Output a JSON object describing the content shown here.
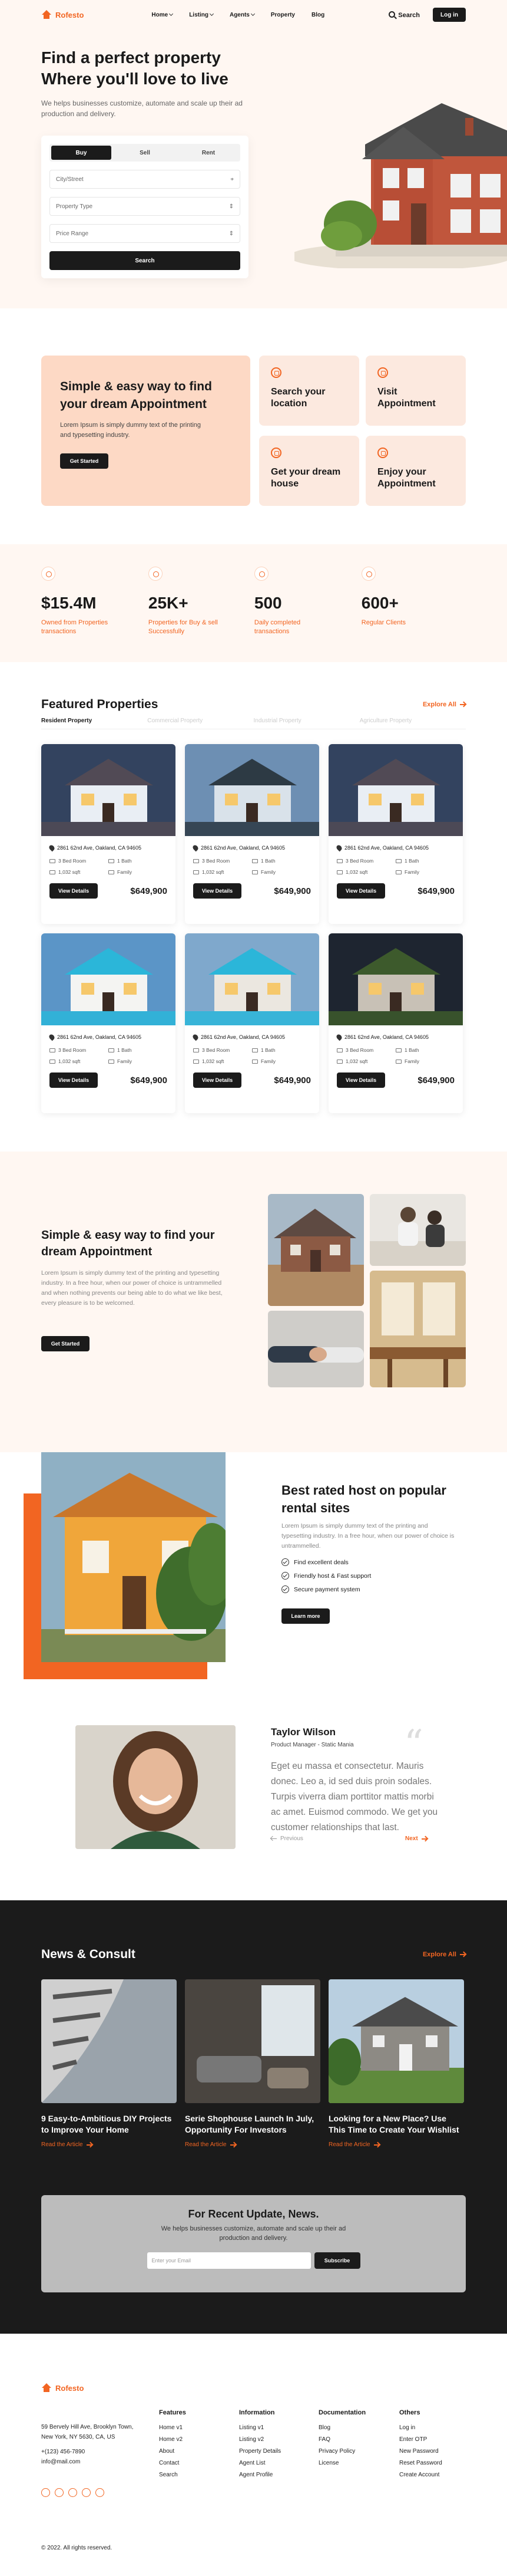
{
  "nav": {
    "brand": "Rofesto",
    "links": [
      "Home",
      "Listing",
      "Agents",
      "Property",
      "Blog"
    ],
    "search": "Search",
    "login": "Log in"
  },
  "hero": {
    "title": "Find a perfect property Where you'll love to live",
    "subtitle": "We helps businesses customize, automate and scale up their ad production and delivery.",
    "tabs": [
      "Buy",
      "Sell",
      "Rent"
    ],
    "fields": [
      "City/Street",
      "Property Type",
      "Price Range"
    ],
    "search_button": "Search"
  },
  "services": {
    "title": "Simple & easy way to find your dream Appointment",
    "text": "Lorem Ipsum is simply dummy text of the printing and typesetting industry.",
    "button": "Get Started",
    "cards": [
      "Search your location",
      "Visit Appointment",
      "Get your dream house",
      "Enjoy your Appointment"
    ]
  },
  "stats": [
    {
      "value": "$15.4M",
      "label": "Owned from Properties transactions"
    },
    {
      "value": "25K+",
      "label": "Properties for Buy & sell Successfully"
    },
    {
      "value": "500",
      "label": "Daily completed transactions"
    },
    {
      "value": "600+",
      "label": "Regular Clients"
    }
  ],
  "featured": {
    "title": "Featured Properties",
    "explore": "Explore All",
    "tabs": [
      "Resident Property",
      "Commercial Property",
      "Industrial Property",
      "Agriculture Property"
    ],
    "cards": [
      {
        "address": "2861 62nd Ave, Oakland, CA 94605",
        "bed": "3 Bed Room",
        "bath": "1 Bath",
        "area": "1,032 sqft",
        "type": "Family",
        "button": "View Details",
        "price": "$649,900"
      },
      {
        "address": "2861 62nd Ave, Oakland, CA 94605",
        "bed": "3 Bed Room",
        "bath": "1 Bath",
        "area": "1,032 sqft",
        "type": "Family",
        "button": "View Details",
        "price": "$649,900"
      },
      {
        "address": "2861 62nd Ave, Oakland, CA 94605",
        "bed": "3 Bed Room",
        "bath": "1 Bath",
        "area": "1,032 sqft",
        "type": "Family",
        "button": "View Details",
        "price": "$649,900"
      },
      {
        "address": "2861 62nd Ave, Oakland, CA 94605",
        "bed": "3 Bed Room",
        "bath": "1 Bath",
        "area": "1,032 sqft",
        "type": "Family",
        "button": "View Details",
        "price": "$649,900"
      },
      {
        "address": "2861 62nd Ave, Oakland, CA 94605",
        "bed": "3 Bed Room",
        "bath": "1 Bath",
        "area": "1,032 sqft",
        "type": "Family",
        "button": "View Details",
        "price": "$649,900"
      },
      {
        "address": "2861 62nd Ave, Oakland, CA 94605",
        "bed": "3 Bed Room",
        "bath": "1 Bath",
        "area": "1,032 sqft",
        "type": "Family",
        "button": "View Details",
        "price": "$649,900"
      }
    ]
  },
  "appointment": {
    "title": "Simple & easy way to find your dream Appointment",
    "text": "Lorem Ipsum is simply dummy text of the printing and typesetting industry. In a free hour, when our power of choice is untrammelled and when nothing prevents our being able to do what we like best, every pleasure is to be welcomed.",
    "button": "Get Started"
  },
  "host": {
    "title": "Best rated host on popular rental sites",
    "text": "Lorem Ipsum is simply dummy text of the printing and typesetting industry. In a free hour, when our power of choice is untrammelled.",
    "items": [
      "Find excellent deals",
      "Friendly host & Fast support",
      "Secure payment system"
    ],
    "button": "Learn more"
  },
  "testimonial": {
    "name": "Taylor Wilson",
    "role": "Product Manager - Static Mania",
    "quote": "Eget eu massa et consectetur. Mauris donec. Leo a, id sed duis proin sodales. Turpis viverra diam porttitor mattis morbi ac amet. Euismod commodo. We get you customer relationships that last.",
    "prev": "Previous",
    "next": "Next"
  },
  "news": {
    "title": "News & Consult",
    "explore": "Explore All",
    "articles": [
      {
        "title": "9 Easy-to-Ambitious DIY Projects to Improve Your Home",
        "link": "Read the Article"
      },
      {
        "title": "Serie Shophouse Launch In July, Opportunity For Investors",
        "link": "Read the Article"
      },
      {
        "title": "Looking for a New Place? Use This Time to Create Your Wishlist",
        "link": "Read the Article"
      }
    ],
    "newsletter": {
      "title": "For Recent Update, News.",
      "text": "We helps businesses customize, automate and scale up their ad production and delivery.",
      "placeholder": "Enter your Email",
      "button": "Subscribe"
    }
  },
  "footer": {
    "brand": "Rofesto",
    "address": "59 Bervely Hill Ave, Brooklyn Town, New York, NY 5630, CA, US",
    "phone": "+(123) 456-7890",
    "email": "info@mail.com",
    "columns": [
      {
        "title": "Features",
        "links": [
          "Home v1",
          "Home v2",
          "About",
          "Contact",
          "Search"
        ]
      },
      {
        "title": "Information",
        "links": [
          "Listing v1",
          "Listing v2",
          "Property Details",
          "Agent List",
          "Agent Profile"
        ]
      },
      {
        "title": "Documentation",
        "links": [
          "Blog",
          "FAQ",
          "Privacy Policy",
          "License"
        ]
      },
      {
        "title": "Others",
        "links": [
          "Log in",
          "Enter OTP",
          "New Password",
          "Reset Password",
          "Create Account"
        ]
      }
    ],
    "copyright": "© 2022. All rights reserved."
  },
  "colors": {
    "accent": "#f26522",
    "dark": "#1b1b1b",
    "cream": "#fff7f2",
    "peach": "#fdd9c5"
  }
}
